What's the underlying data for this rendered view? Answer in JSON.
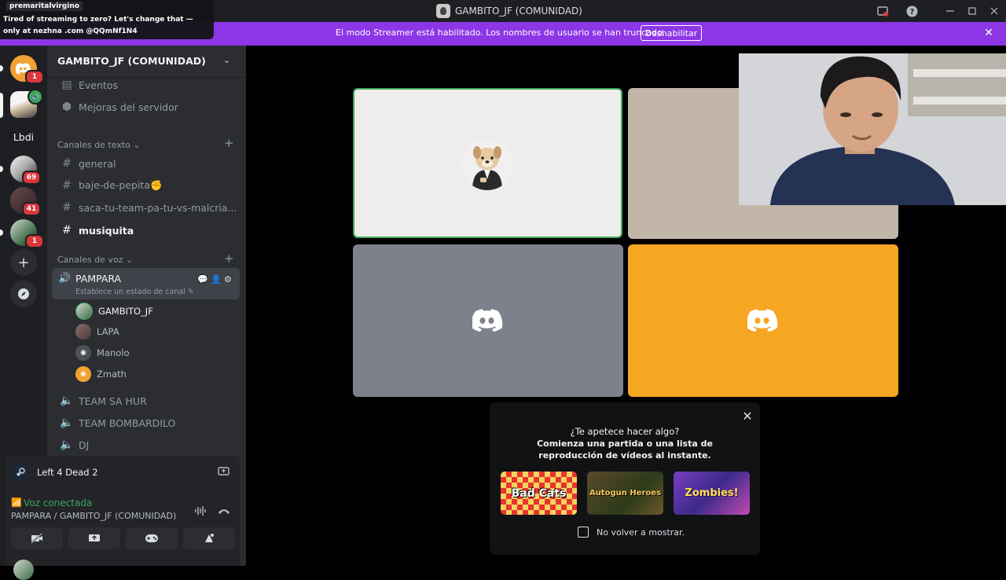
{
  "window": {
    "title": "GAMBITO_JF (COMUNIDAD)"
  },
  "promo": {
    "username": "premaritalvirgino",
    "message": "Tired of streaming to zero? Let's change that — only at nezhna .com @QQmNf1N4"
  },
  "banner": {
    "text": "El modo Streamer está habilitado. Los nombres de usuario se han truncado.",
    "button": "Deshabilitar"
  },
  "rail": {
    "badges": [
      "1",
      "69",
      "41",
      "1"
    ],
    "text_server": "Lbdi"
  },
  "sidebar": {
    "server_name": "GAMBITO_JF (COMUNIDAD)",
    "top_items": [
      {
        "label": "Eventos",
        "icon": "calendar-icon"
      },
      {
        "label": "Mejoras del servidor",
        "icon": "boost-icon"
      }
    ],
    "text_category": "Canales de texto",
    "text_channels": [
      "general",
      "baje-de-pepita✊",
      "saca-tu-team-pa-tu-vs-malcria...",
      "musiquita"
    ],
    "voice_category": "Canales de voz",
    "active_voice": {
      "name": "PAMPARA",
      "status": "Establece un estado de canal"
    },
    "members": [
      "GAMBITO_JF",
      "LAPA",
      "Manolo",
      "Zmath"
    ],
    "voice_channels": [
      "TEAM SA HUR",
      "TEAM BOMBARDILO",
      "DJ"
    ]
  },
  "activity": {
    "game": "Left 4 Dead 2"
  },
  "voice_panel": {
    "status": "Voz conectada",
    "location": "PAMPARA / GAMBITO_JF (COMUNIDAD)"
  },
  "popup": {
    "title": "¿Te apetece hacer algo?",
    "body": "Comienza una partida o una lista de reproducción de vídeos al instante.",
    "games": [
      {
        "title": "Bad Cats"
      },
      {
        "title": "Autogun Heroes"
      },
      {
        "title": "Zombies!"
      }
    ],
    "dont_show": "No volver a mostrar."
  },
  "colors": {
    "banner": "#8d36e6",
    "tile_grey": "#7c818c",
    "tile_orange": "#f5a623",
    "speaking_border": "#3ba55d",
    "voice_connected": "#3ba55d"
  }
}
